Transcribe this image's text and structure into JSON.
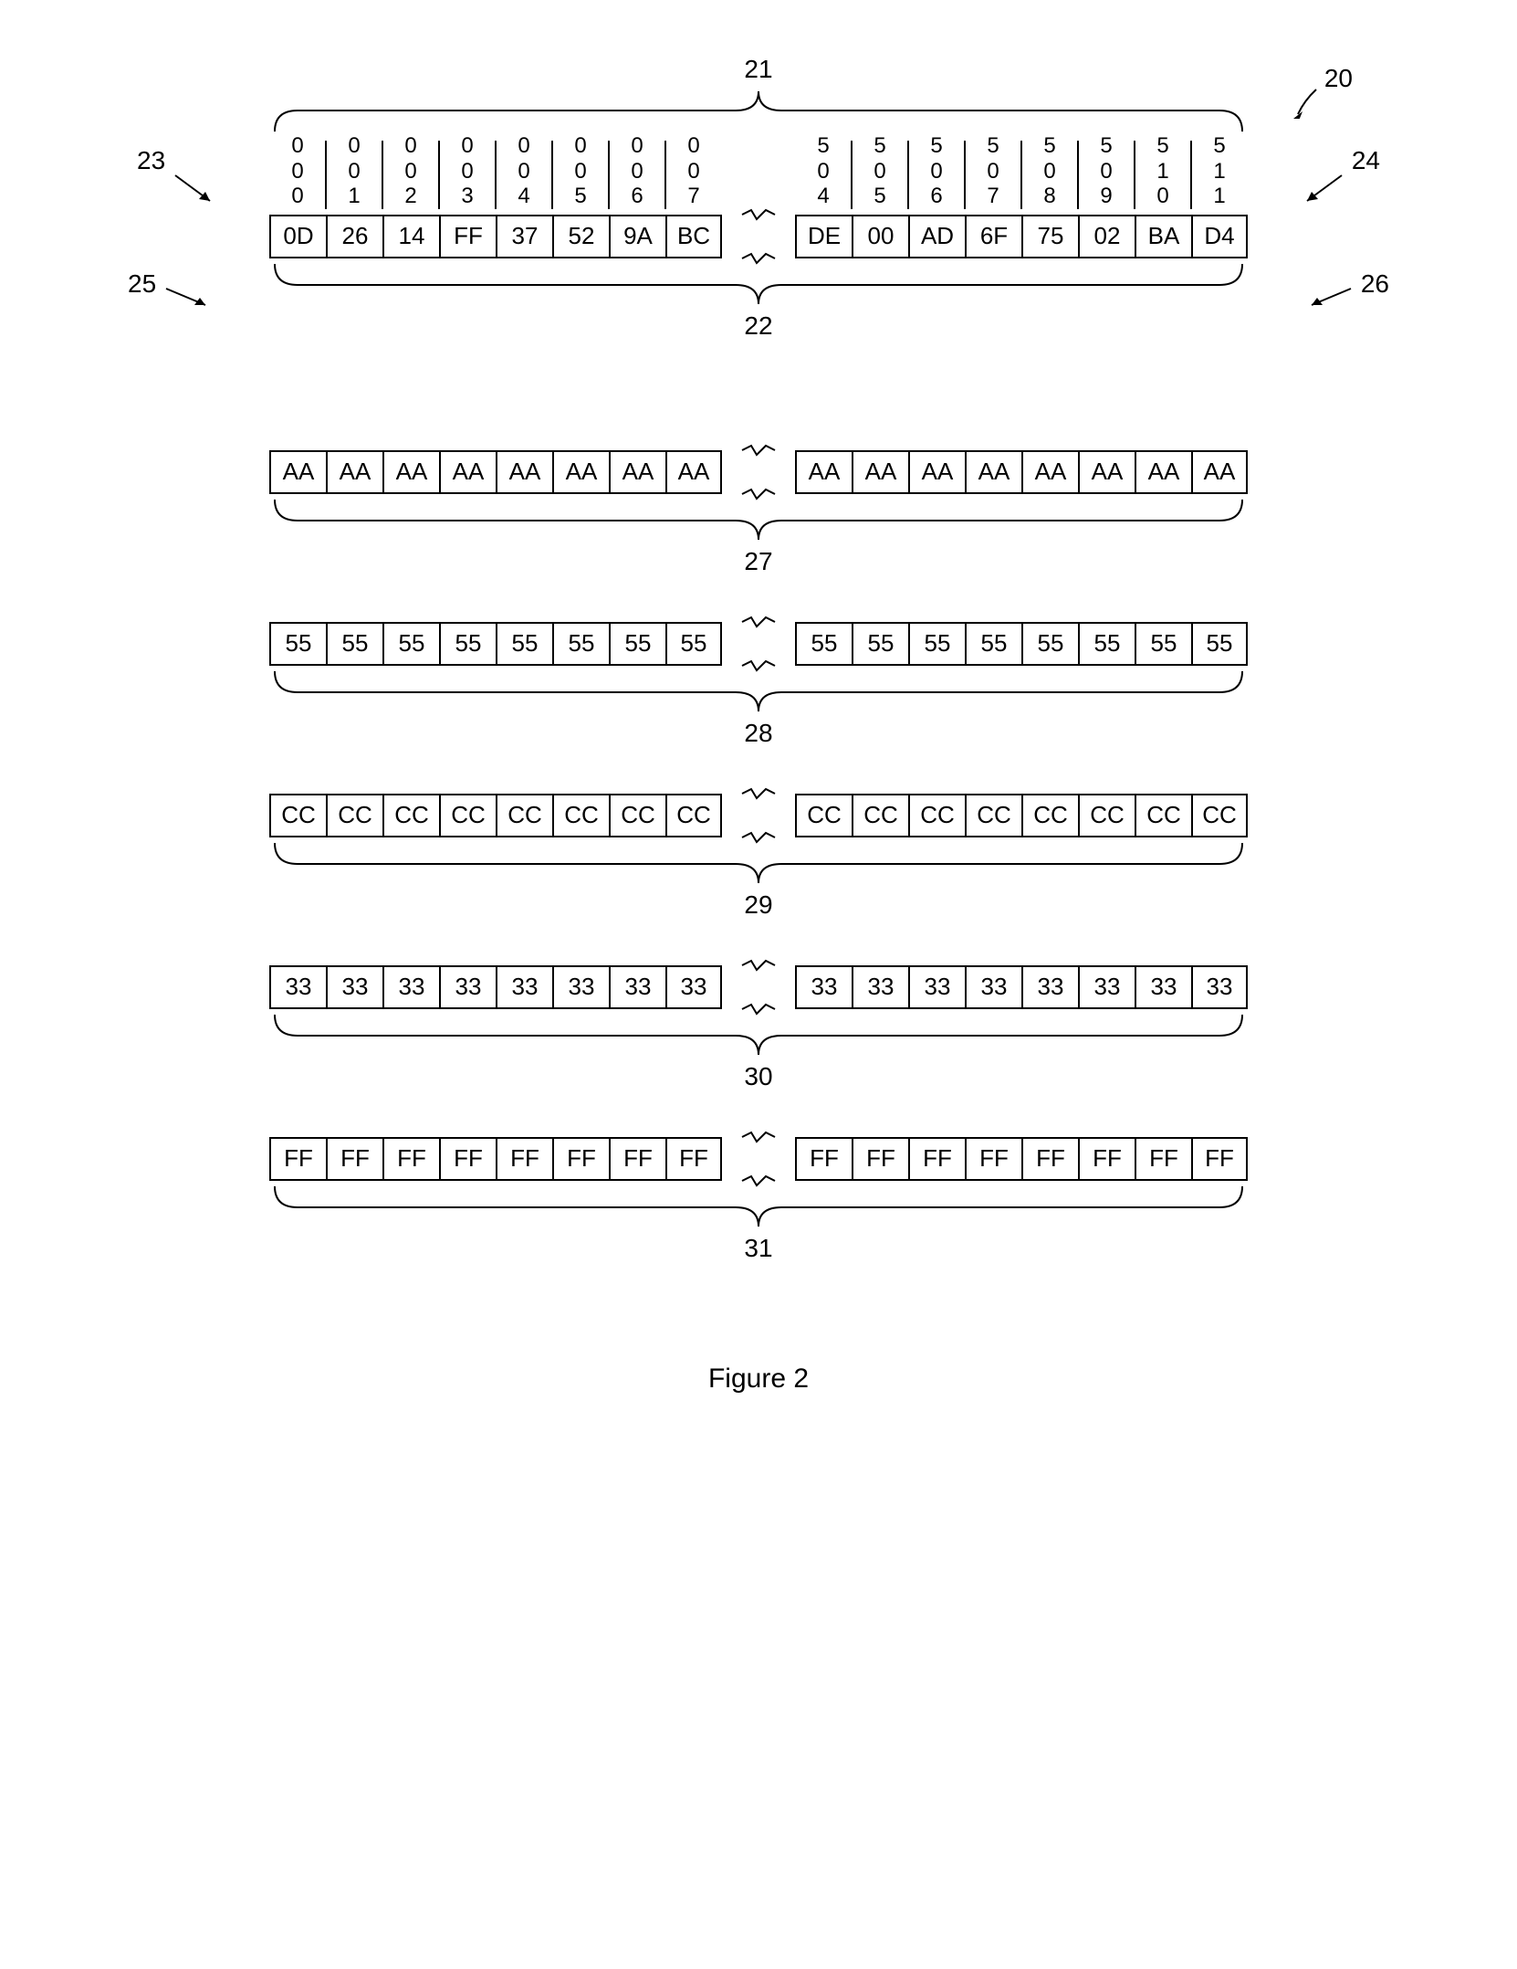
{
  "figure_caption": "Figure 2",
  "top_right_label": "20",
  "labels": {
    "addresses_brace": "21",
    "data_brace": "22",
    "left_addr": "23",
    "right_addr": "24",
    "left_data": "25",
    "right_data": "26"
  },
  "addresses_left": [
    "000",
    "001",
    "002",
    "003",
    "004",
    "005",
    "006",
    "007"
  ],
  "addresses_right": [
    "504",
    "505",
    "506",
    "507",
    "508",
    "509",
    "510",
    "511"
  ],
  "rows": [
    {
      "id": "22",
      "left": [
        "0D",
        "26",
        "14",
        "FF",
        "37",
        "52",
        "9A",
        "BC"
      ],
      "right": [
        "DE",
        "00",
        "AD",
        "6F",
        "75",
        "02",
        "BA",
        "D4"
      ]
    },
    {
      "id": "27",
      "left": [
        "AA",
        "AA",
        "AA",
        "AA",
        "AA",
        "AA",
        "AA",
        "AA"
      ],
      "right": [
        "AA",
        "AA",
        "AA",
        "AA",
        "AA",
        "AA",
        "AA",
        "AA"
      ]
    },
    {
      "id": "28",
      "left": [
        "55",
        "55",
        "55",
        "55",
        "55",
        "55",
        "55",
        "55"
      ],
      "right": [
        "55",
        "55",
        "55",
        "55",
        "55",
        "55",
        "55",
        "55"
      ]
    },
    {
      "id": "29",
      "left": [
        "CC",
        "CC",
        "CC",
        "CC",
        "CC",
        "CC",
        "CC",
        "CC"
      ],
      "right": [
        "CC",
        "CC",
        "CC",
        "CC",
        "CC",
        "CC",
        "CC",
        "CC"
      ]
    },
    {
      "id": "30",
      "left": [
        "33",
        "33",
        "33",
        "33",
        "33",
        "33",
        "33",
        "33"
      ],
      "right": [
        "33",
        "33",
        "33",
        "33",
        "33",
        "33",
        "33",
        "33"
      ]
    },
    {
      "id": "31",
      "left": [
        "FF",
        "FF",
        "FF",
        "FF",
        "FF",
        "FF",
        "FF",
        "FF"
      ],
      "right": [
        "FF",
        "FF",
        "FF",
        "FF",
        "FF",
        "FF",
        "FF",
        "FF"
      ]
    }
  ]
}
